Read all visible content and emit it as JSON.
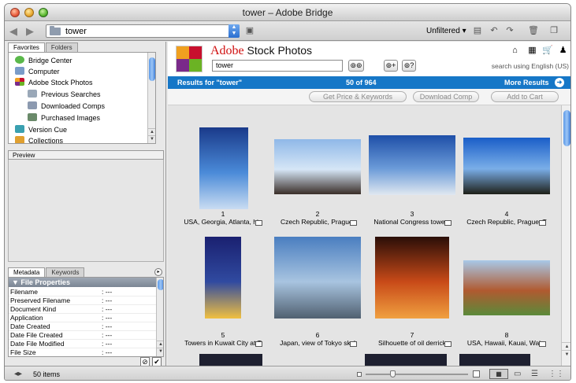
{
  "window": {
    "title": "tower – Adobe Bridge"
  },
  "toolbar": {
    "path": "tower",
    "filter": "Unfiltered"
  },
  "panels": {
    "favorites_tab": "Favorites",
    "folders_tab": "Folders",
    "favorites": [
      "Bridge Center",
      "Computer",
      "Adobe Stock Photos",
      "Previous Searches",
      "Downloaded Comps",
      "Purchased Images",
      "Version Cue",
      "Collections"
    ],
    "preview_tab": "Preview",
    "metadata_tab": "Metadata",
    "keywords_tab": "Keywords",
    "file_properties": "File Properties",
    "metadata_rows": [
      {
        "key": "Filename",
        "value": ": ---"
      },
      {
        "key": "Preserved Filename",
        "value": ": ---"
      },
      {
        "key": "Document Kind",
        "value": ": ---"
      },
      {
        "key": "Application",
        "value": ": ---"
      },
      {
        "key": "Date Created",
        "value": ": ---"
      },
      {
        "key": "Date File Created",
        "value": ": ---"
      },
      {
        "key": "Date File Modified",
        "value": ": ---"
      },
      {
        "key": "File Size",
        "value": ": ---"
      }
    ]
  },
  "stock": {
    "brand_adobe": "Adobe",
    "brand_rest": "Stock Photos",
    "search_value": "tower",
    "search_lang": "search using English (US)",
    "results_label": "Results for \"tower\"",
    "results_count": "50 of 964",
    "more_results": "More Results",
    "btn_price": "Get Price & Keywords",
    "btn_comp": "Download Comp",
    "btn_cart": "Add to Cart"
  },
  "thumbnails": [
    {
      "num": "1",
      "caption": "USA, Georgia, Atlanta, hig",
      "colors": [
        "#1a3a8a",
        "#4a8ad8",
        "#c9dcf2"
      ]
    },
    {
      "num": "2",
      "caption": "Czech Republic, Prague,",
      "colors": [
        "#8fb8e8",
        "#d6e6f6",
        "#3a2e28"
      ]
    },
    {
      "num": "3",
      "caption": "National Congress towers",
      "colors": [
        "#1e4fa8",
        "#6a9ad8",
        "#e0e8f0"
      ]
    },
    {
      "num": "4",
      "caption": "Czech Republic, Prague, T",
      "colors": [
        "#1a5ec8",
        "#7aaee8",
        "#1e2018"
      ]
    },
    {
      "num": "5",
      "caption": "Towers in Kuwait City at T",
      "colors": [
        "#1a2070",
        "#304aa0",
        "#f0c040"
      ]
    },
    {
      "num": "6",
      "caption": "Japan, view of Tokyo skyl",
      "colors": [
        "#4a7ec0",
        "#a8c4e0",
        "#506070"
      ]
    },
    {
      "num": "7",
      "caption": "Silhouette of oil derrick",
      "colors": [
        "#2a0e08",
        "#c84a18",
        "#f0a040"
      ]
    },
    {
      "num": "8",
      "caption": "USA, Hawaii, Kauai, Waim",
      "colors": [
        "#a8c8e8",
        "#b05a30",
        "#5a8a3a"
      ]
    }
  ],
  "status": {
    "items": "50 items"
  }
}
